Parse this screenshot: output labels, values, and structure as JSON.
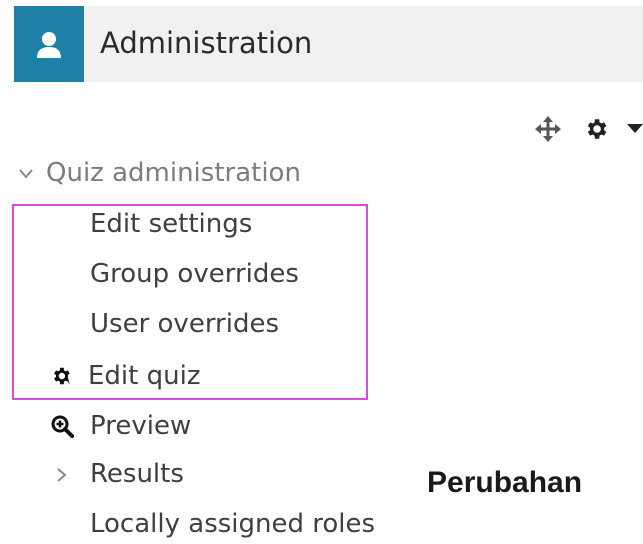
{
  "header": {
    "title": "Administration",
    "icon": "user-icon"
  },
  "controls": {
    "move_icon": "move-icon",
    "gear_icon": "gear-icon",
    "caret_icon": "caret-down-icon"
  },
  "nav": {
    "section_label": "Quiz administration",
    "items": [
      {
        "label": "Edit settings",
        "icon": ""
      },
      {
        "label": "Group overrides",
        "icon": ""
      },
      {
        "label": "User overrides",
        "icon": ""
      },
      {
        "label": "Edit quiz",
        "icon": "gear-icon"
      },
      {
        "label": "Preview",
        "icon": "magnifier-plus-icon"
      },
      {
        "label": "Results",
        "icon": "chevron-right-icon"
      },
      {
        "label": "Locally assigned roles",
        "icon": ""
      }
    ]
  },
  "caption": "Perubahan",
  "colors": {
    "header_bg": "#f1f1f1",
    "header_icon_bg": "#1f7fa6",
    "highlight": "#d94be6"
  }
}
